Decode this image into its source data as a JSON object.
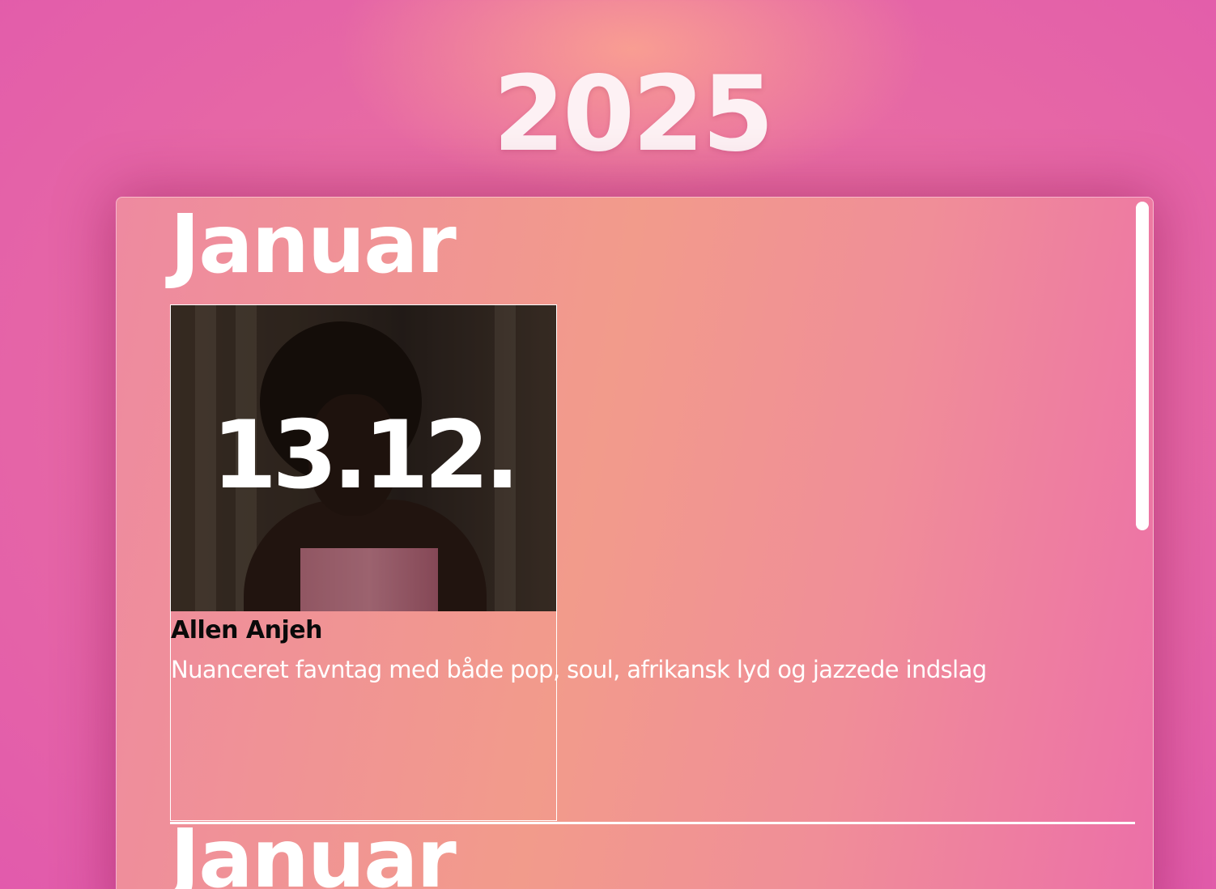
{
  "page": {
    "year": "2025"
  },
  "panel": {
    "sections": [
      {
        "month": "Januar",
        "events": [
          {
            "date": "13.12.",
            "artist": "Allen Anjeh",
            "description": "Nuanceret favntag med både pop, soul, afrikansk lyd og jazzede indslag"
          }
        ]
      },
      {
        "month": "Januar"
      }
    ]
  },
  "colors": {
    "background": "#e76aa4",
    "panel_start": "#ee8aa0",
    "panel_mid": "#f29b8b",
    "panel_end": "#ec6fa8",
    "text_light": "#ffffff",
    "text_dark": "#0a0a0a"
  }
}
